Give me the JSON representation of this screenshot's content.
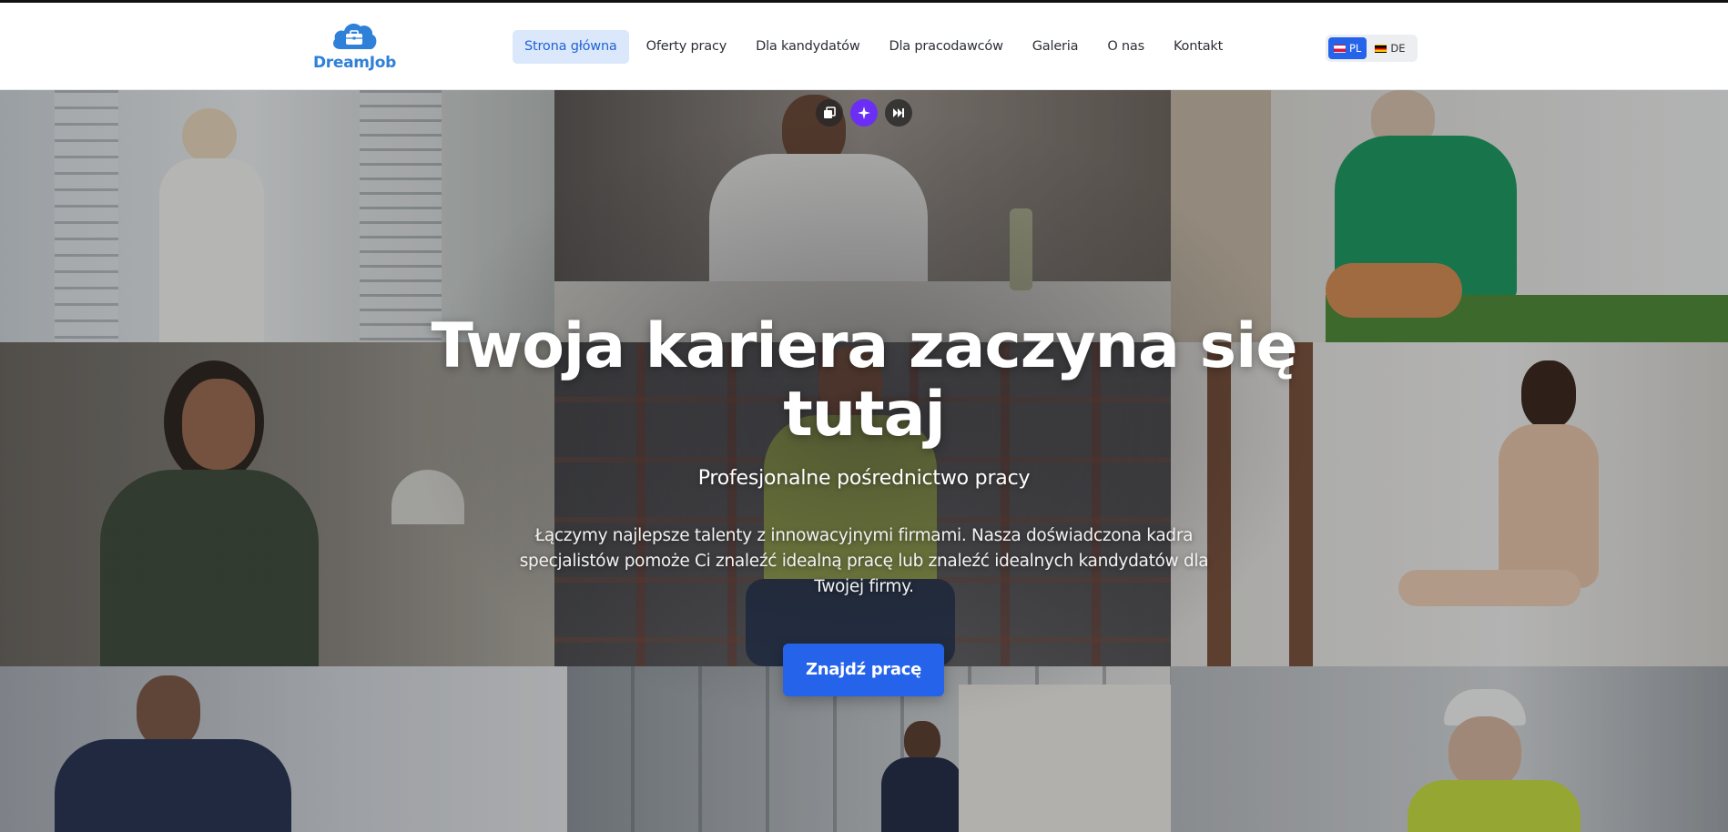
{
  "brand": {
    "name": "DreamJob",
    "color": "#2f80d8",
    "icon": "briefcase-cloud-icon"
  },
  "nav": {
    "items": [
      {
        "label": "Strona główna",
        "active": true
      },
      {
        "label": "Oferty pracy",
        "active": false
      },
      {
        "label": "Dla kandydatów",
        "active": false
      },
      {
        "label": "Dla pracodawców",
        "active": false
      },
      {
        "label": "Galeria",
        "active": false
      },
      {
        "label": "O nas",
        "active": false
      },
      {
        "label": "Kontakt",
        "active": false
      }
    ]
  },
  "language": {
    "options": [
      {
        "code": "PL",
        "flag": "flag-poland-icon",
        "active": true
      },
      {
        "code": "DE",
        "flag": "flag-germany-icon",
        "active": false
      }
    ]
  },
  "hero": {
    "title": "Twoja kariera zaczyna się tutaj",
    "subtitle": "Profesjonalne pośrednictwo pracy",
    "description": "Łączymy najlepsze talenty z innowacyjnymi firmami. Nasza doświadczona kadra specjalistów pomoże Ci znaleźć idealną pracę lub znaleźć idealnych kandydatów dla Twojej firmy.",
    "cta_label": "Znajdź pracę",
    "controls": [
      "copy-icon",
      "sparkle-icon",
      "skip-forward-icon"
    ]
  },
  "colors": {
    "accent": "#2563eb",
    "active_nav_bg": "#dbe8fb",
    "active_nav_text": "#1f63d6"
  }
}
